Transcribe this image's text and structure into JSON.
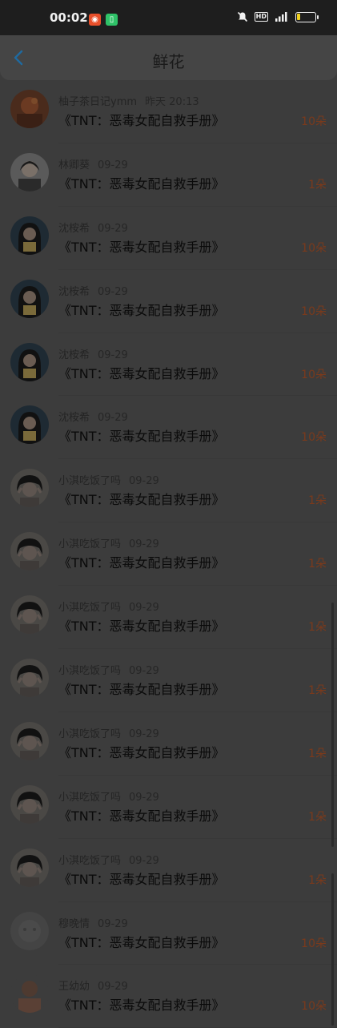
{
  "status_bar": {
    "time": "00:02",
    "icons": [
      "weibo-app-icon",
      "wechat-app-icon",
      "mute-icon",
      "hd-icon",
      "signal-icon",
      "battery-icon"
    ],
    "hd_label": "HD",
    "battery_level": 0.2
  },
  "nav": {
    "title": "鲜花",
    "back_icon": "back-chevron-icon"
  },
  "colors": {
    "count": "#7a3a1c",
    "back": "#1f6aa0",
    "battery": "#f2d21f"
  },
  "items": [
    {
      "name": "柚子茶日记ymm",
      "date": "昨天 20:13",
      "title": "《TNT：恶毒女配自救手册》",
      "count": "10朵",
      "avatar": "a1"
    },
    {
      "name": "林卿葵",
      "date": "09-29",
      "title": "《TNT：恶毒女配自救手册》",
      "count": "1朵",
      "avatar": "a2"
    },
    {
      "name": "沈桉希",
      "date": "09-29",
      "title": "《TNT：恶毒女配自救手册》",
      "count": "10朵",
      "avatar": "a3"
    },
    {
      "name": "沈桉希",
      "date": "09-29",
      "title": "《TNT：恶毒女配自救手册》",
      "count": "10朵",
      "avatar": "a3"
    },
    {
      "name": "沈桉希",
      "date": "09-29",
      "title": "《TNT：恶毒女配自救手册》",
      "count": "10朵",
      "avatar": "a3"
    },
    {
      "name": "沈桉希",
      "date": "09-29",
      "title": "《TNT：恶毒女配自救手册》",
      "count": "10朵",
      "avatar": "a3"
    },
    {
      "name": "小淇吃饭了吗",
      "date": "09-29",
      "title": "《TNT：恶毒女配自救手册》",
      "count": "1朵",
      "avatar": "a4"
    },
    {
      "name": "小淇吃饭了吗",
      "date": "09-29",
      "title": "《TNT：恶毒女配自救手册》",
      "count": "1朵",
      "avatar": "a4"
    },
    {
      "name": "小淇吃饭了吗",
      "date": "09-29",
      "title": "《TNT：恶毒女配自救手册》",
      "count": "1朵",
      "avatar": "a4"
    },
    {
      "name": "小淇吃饭了吗",
      "date": "09-29",
      "title": "《TNT：恶毒女配自救手册》",
      "count": "1朵",
      "avatar": "a4"
    },
    {
      "name": "小淇吃饭了吗",
      "date": "09-29",
      "title": "《TNT：恶毒女配自救手册》",
      "count": "1朵",
      "avatar": "a4"
    },
    {
      "name": "小淇吃饭了吗",
      "date": "09-29",
      "title": "《TNT：恶毒女配自救手册》",
      "count": "1朵",
      "avatar": "a4"
    },
    {
      "name": "小淇吃饭了吗",
      "date": "09-29",
      "title": "《TNT：恶毒女配自救手册》",
      "count": "1朵",
      "avatar": "a4"
    },
    {
      "name": "穆晚情",
      "date": "09-29",
      "title": "《TNT：恶毒女配自救手册》",
      "count": "10朵",
      "avatar": "a5"
    },
    {
      "name": "王幼幼",
      "date": "09-29",
      "title": "《TNT：恶毒女配自救手册》",
      "count": "10朵",
      "avatar": "a6"
    }
  ]
}
